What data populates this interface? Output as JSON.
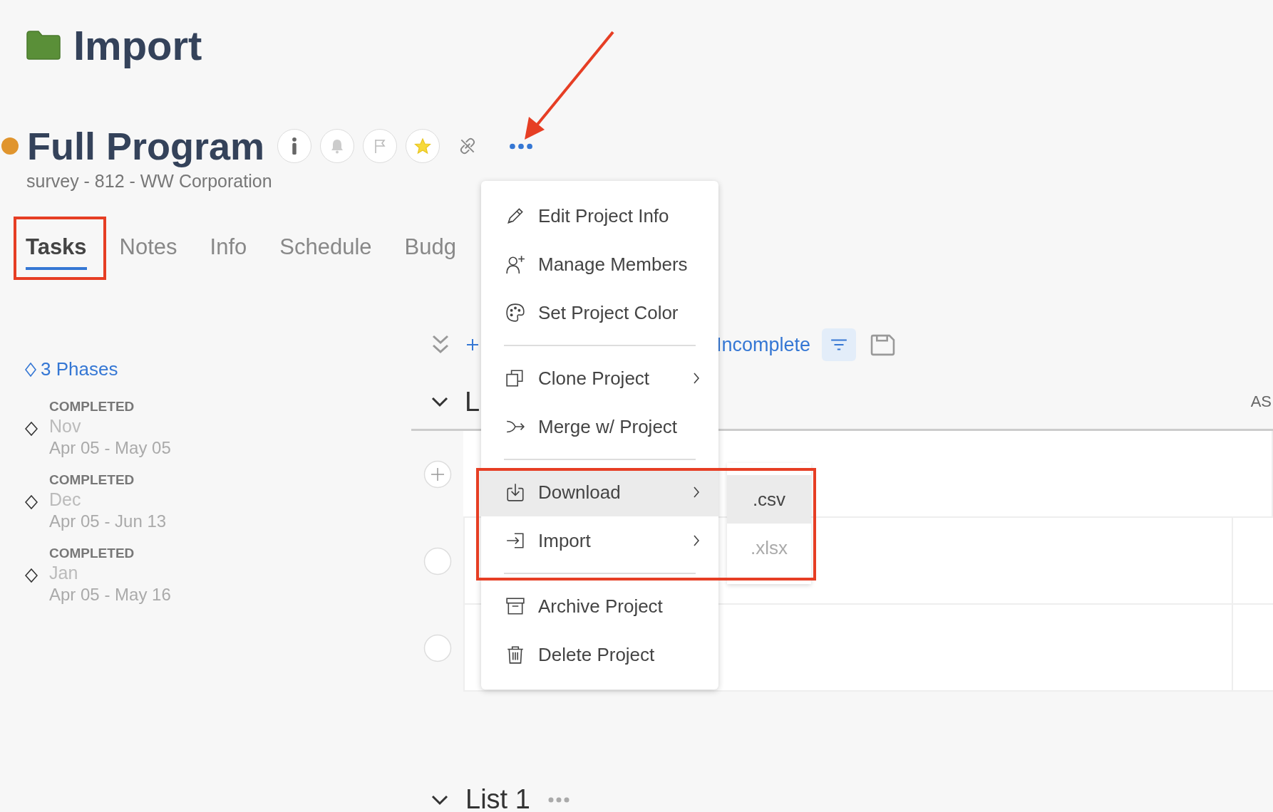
{
  "folder_title": "Import",
  "project": {
    "name": "Full Program",
    "color": "#e0952e",
    "subtitle": "survey - 812 - WW Corporation",
    "favorite": true
  },
  "tabs": [
    {
      "label": "Tasks",
      "selected": true
    },
    {
      "label": "Notes",
      "selected": false
    },
    {
      "label": "Info",
      "selected": false
    },
    {
      "label": "Schedule",
      "selected": false
    },
    {
      "label": "Budg",
      "selected": false
    }
  ],
  "phases": {
    "summary": "3 Phases",
    "items": [
      {
        "status": "COMPLETED",
        "name": "Nov",
        "dates": "Apr 05 - May 05"
      },
      {
        "status": "COMPLETED",
        "name": "Dec",
        "dates": "Apr 05 - Jun 13"
      },
      {
        "status": "COMPLETED",
        "name": "Jan",
        "dates": "Apr 05 - May 16"
      }
    ]
  },
  "toolbar": {
    "filter_label": "Incomplete"
  },
  "list": {
    "title": "L",
    "column_2": "AS",
    "rows": [
      {
        "kind": "add"
      },
      {
        "kind": "task",
        "checked": false
      },
      {
        "kind": "task",
        "checked": false
      }
    ]
  },
  "next_list": {
    "title": "List 1"
  },
  "menu": {
    "items": [
      {
        "kind": "item",
        "label": "Edit Project Info",
        "submenu": false,
        "selected": false
      },
      {
        "kind": "item",
        "label": "Manage Members",
        "submenu": false,
        "selected": false
      },
      {
        "kind": "item",
        "label": "Set Project Color",
        "submenu": false,
        "selected": false
      },
      {
        "kind": "separator"
      },
      {
        "kind": "item",
        "label": "Clone Project",
        "submenu": true,
        "selected": false
      },
      {
        "kind": "item",
        "label": "Merge w/ Project",
        "submenu": false,
        "selected": false
      },
      {
        "kind": "separator"
      },
      {
        "kind": "item",
        "label": "Download",
        "submenu": true,
        "selected": true
      },
      {
        "kind": "item",
        "label": "Import",
        "submenu": true,
        "selected": false
      },
      {
        "kind": "separator"
      },
      {
        "kind": "item",
        "label": "Archive Project",
        "submenu": false,
        "selected": false
      },
      {
        "kind": "item",
        "label": "Delete Project",
        "submenu": false,
        "selected": false
      }
    ]
  },
  "submenu": {
    "items": [
      {
        "label": ".csv",
        "selected": true,
        "disabled": false
      },
      {
        "label": ".xlsx",
        "selected": false,
        "disabled": true
      }
    ]
  },
  "annotations": [
    {
      "kind": "arrow"
    },
    {
      "kind": "box"
    },
    {
      "kind": "box"
    }
  ]
}
